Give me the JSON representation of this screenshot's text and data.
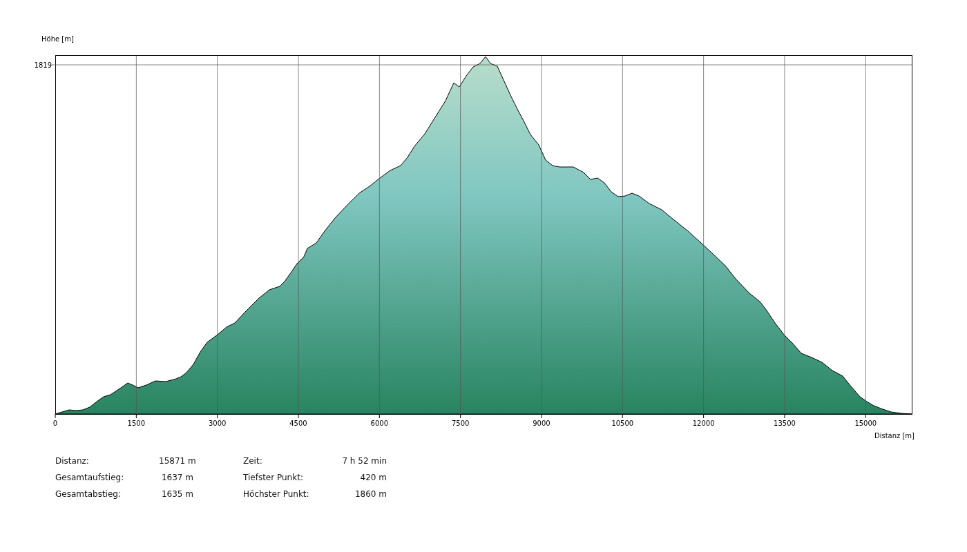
{
  "chart": {
    "ylabel": "Höhe [m]",
    "yticks": [
      "1819"
    ],
    "xlabel": "Distanz [m]",
    "xticks": [
      "0",
      "1500",
      "3000",
      "4500",
      "6000",
      "7500",
      "9000",
      "10500",
      "12000",
      "13500",
      "15000"
    ]
  },
  "stats": [
    [
      {
        "label": "Distanz:",
        "value": "15871 m"
      },
      {
        "label": "Gesamtaufstieg:",
        "value": "1637 m"
      },
      {
        "label": "Gesamtabstieg:",
        "value": "1635 m"
      }
    ],
    [
      {
        "label": "Zeit:",
        "value": "7 h 52 min"
      },
      {
        "label": "Tiefster Punkt:",
        "value": "420 m"
      },
      {
        "label": "Höchster Punkt:",
        "value": "1860 m"
      }
    ]
  ]
}
